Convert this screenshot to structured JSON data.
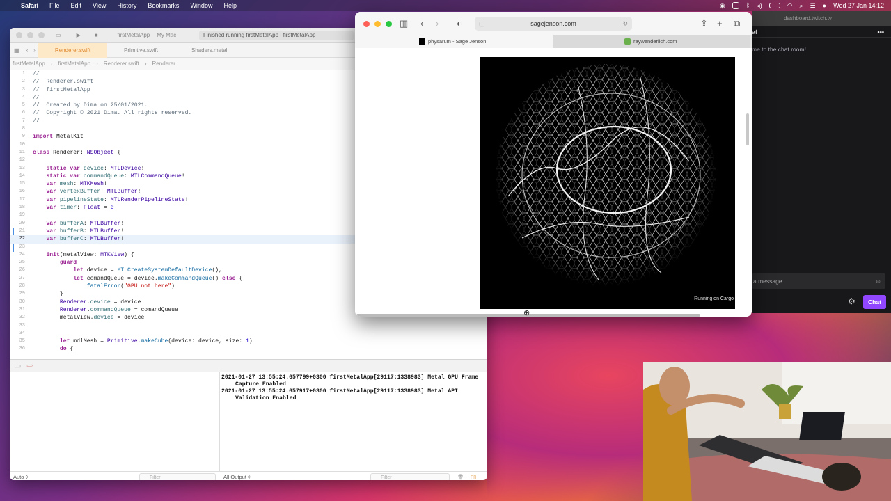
{
  "menubar": {
    "app": "Safari",
    "items": [
      "File",
      "Edit",
      "View",
      "History",
      "Bookmarks",
      "Window",
      "Help"
    ],
    "datetime": "Wed 27 Jan  14:12"
  },
  "xcode": {
    "scheme": "firstMetalApp",
    "destination": "My Mac",
    "status": "Finished running firstMetalApp : firstMetalApp",
    "tabs": [
      "Renderer.swift",
      "Primitive.swift",
      "Shaders.metal"
    ],
    "breadcrumb": [
      "firstMetalApp",
      "firstMetalApp",
      "Renderer.swift",
      "Renderer"
    ],
    "console": [
      "2021-01-27 13:55:24.657799+0300 firstMetalApp[29117:1338983] Metal GPU Frame Capture Enabled",
      "2021-01-27 13:55:24.657917+0300 firstMetalApp[29117:1338983] Metal API Validation Enabled"
    ],
    "bottom": {
      "auto": "Auto ◊",
      "filter": "Filter",
      "output": "All Output ◊",
      "filter2": "Filter"
    }
  },
  "safari": {
    "url": "sagejenson.com",
    "tabs": [
      "physarum - Sage Jenson",
      "raywenderlich.com"
    ],
    "running_prefix": "Running on ",
    "running_link": "Cargo"
  },
  "twitch": {
    "url": "dashboard.twitch.tv",
    "header": "at",
    "welcome": "me to the chat room!",
    "input": "a message",
    "chat_button": "Chat"
  }
}
